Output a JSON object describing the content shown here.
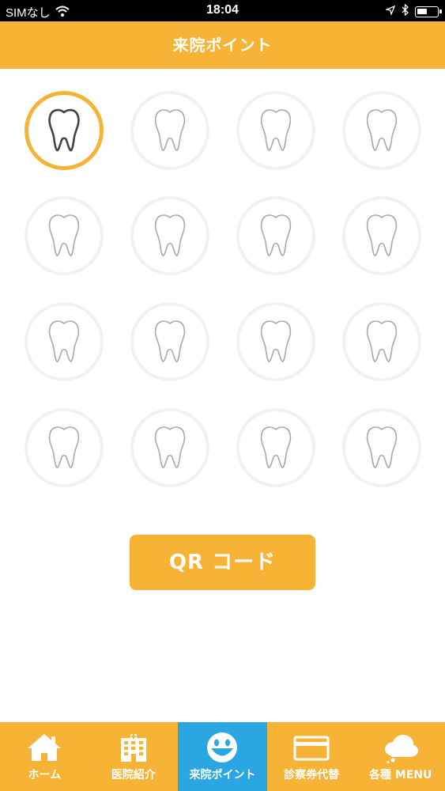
{
  "status_bar": {
    "carrier": "SIMなし",
    "time": "18:04"
  },
  "header": {
    "title": "来院ポイント"
  },
  "stamps": {
    "total": 16,
    "collected": 1
  },
  "qr_button": {
    "label": "QR コード"
  },
  "tab_bar": {
    "active_index": 2,
    "items": [
      {
        "label": "ホーム",
        "icon": "home-icon"
      },
      {
        "label": "医院紹介",
        "icon": "building-icon"
      },
      {
        "label": "来院ポイント",
        "icon": "smile-icon"
      },
      {
        "label": "診察券代替",
        "icon": "card-icon"
      },
      {
        "label": "各種 MENU",
        "icon": "cloud-icon"
      }
    ]
  },
  "colors": {
    "accent": "#f6b335",
    "active_tab": "#2aa6e2"
  }
}
